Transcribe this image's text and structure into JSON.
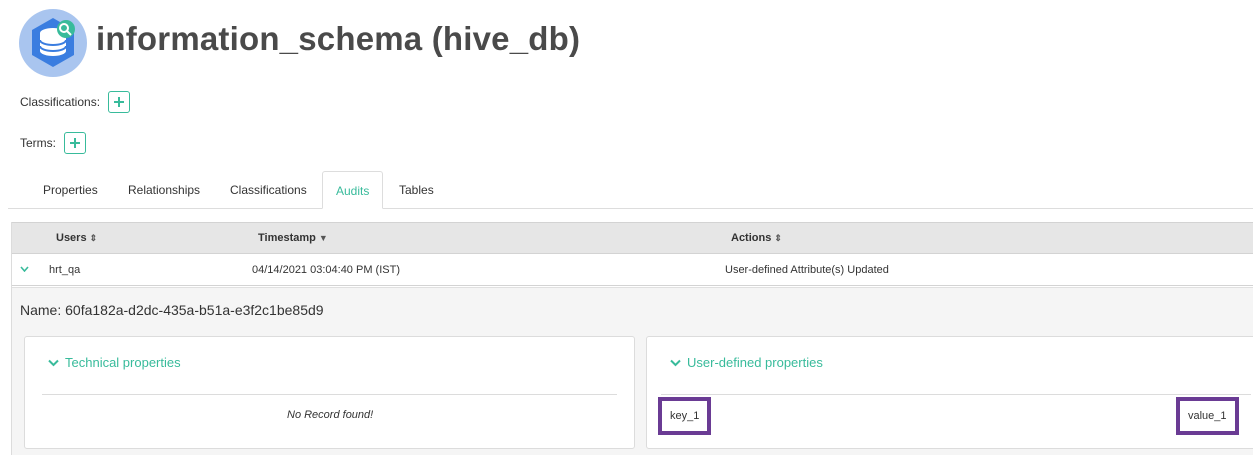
{
  "header": {
    "title": "information_schema (hive_db)",
    "icon": "database-icon",
    "accent_color": "#38bb9b"
  },
  "classifications": {
    "label": "Classifications:",
    "add_icon": "plus-icon"
  },
  "terms": {
    "label": "Terms:",
    "add_icon": "plus-icon"
  },
  "tabs": [
    {
      "label": "Properties",
      "active": false
    },
    {
      "label": "Relationships",
      "active": false
    },
    {
      "label": "Classifications",
      "active": false
    },
    {
      "label": "Audits",
      "active": true
    },
    {
      "label": "Tables",
      "active": false
    }
  ],
  "audits_table": {
    "columns": [
      {
        "label": "Users",
        "sort": "sortable"
      },
      {
        "label": "Timestamp",
        "sort": "descending"
      },
      {
        "label": "Actions",
        "sort": "sortable"
      }
    ],
    "rows": [
      {
        "user": "hrt_qa",
        "timestamp": "04/14/2021 03:04:40 PM (IST)",
        "action": "User-defined Attribute(s) Updated",
        "expanded": true
      }
    ],
    "detail": {
      "name": "Name: 60fa182a-d2dc-435a-b51a-e3f2c1be85d9",
      "technical": {
        "title": "Technical properties",
        "empty_message": "No Record found!"
      },
      "user_defined": {
        "title": "User-defined properties",
        "key": "key_1",
        "value": "value_1",
        "highlight_color": "#6a3b94"
      }
    }
  }
}
